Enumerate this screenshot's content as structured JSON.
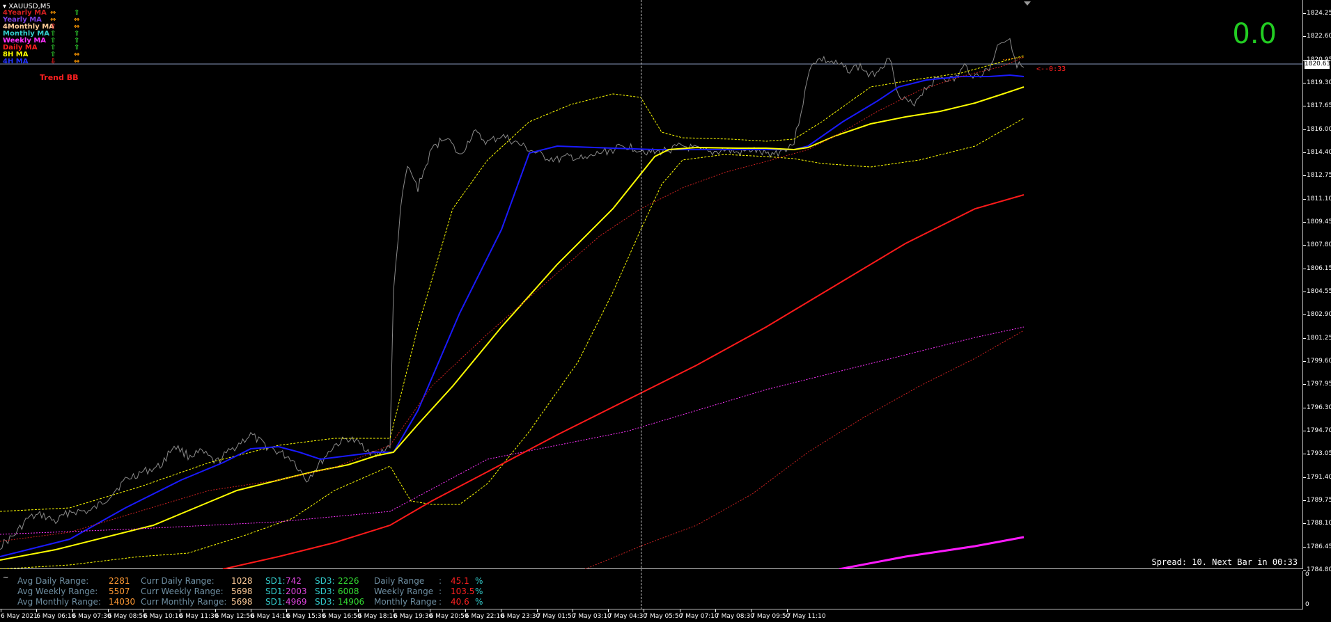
{
  "window": {
    "symbol": "XAUUSD,M5"
  },
  "legend": [
    {
      "name": "4Yearly MA",
      "sym_a": "⇔",
      "sym_b": "⇧",
      "color": "#d02020",
      "a_color": "#ff9900",
      "b_color": "#33dd33"
    },
    {
      "name": "Yearly MA",
      "sym_a": "⇔",
      "sym_b": "⇔",
      "color": "#7b3fe4",
      "a_color": "#ff9900",
      "b_color": "#ff9900"
    },
    {
      "name": "4Monthly MA",
      "sym_a": "⇧",
      "sym_b": "⇔",
      "color": "#ffcc99",
      "a_color": "#ff4444",
      "b_color": "#ff9900"
    },
    {
      "name": "Monthly MA",
      "sym_a": "⇧",
      "sym_b": "⇧",
      "color": "#33cccc",
      "a_color": "#33dd33",
      "b_color": "#33dd33"
    },
    {
      "name": "Weekly MA",
      "sym_a": "⇧",
      "sym_b": "⇧",
      "color": "#ff33ff",
      "a_color": "#33dd33",
      "b_color": "#33dd33"
    },
    {
      "name": "Daily MA",
      "sym_a": "⇧",
      "sym_b": "⇧",
      "color": "#ff2020",
      "a_color": "#33dd33",
      "b_color": "#33dd33"
    },
    {
      "name": "8H MA",
      "sym_a": "⇧",
      "sym_b": "⇔",
      "color": "#ffff00",
      "a_color": "#33dd33",
      "b_color": "#ff9900"
    },
    {
      "name": "4H MA",
      "sym_a": "⇩",
      "sym_b": "⇔",
      "color": "#2233ff",
      "a_color": "#ff2020",
      "b_color": "#ff9900"
    }
  ],
  "trend_label": "Trend BB",
  "big_value": "0.0",
  "price_axis": {
    "ticks": [
      "1824.25",
      "1822.60",
      "1820.95",
      "1819.30",
      "1817.65",
      "1816.00",
      "1814.40",
      "1812.75",
      "1811.10",
      "1809.45",
      "1807.80",
      "1806.15",
      "1804.55",
      "1802.90",
      "1801.25",
      "1799.60",
      "1797.95",
      "1796.30",
      "1794.70",
      "1793.05",
      "1791.40",
      "1789.75",
      "1788.10",
      "1786.45",
      "1784.80"
    ],
    "current_price": "1820.63",
    "range": [
      1784.8,
      1825.1
    ]
  },
  "price_arrow_label": "<--0:33",
  "spread_text": "Spread: 10. Next Bar in 00:33",
  "sub_panel": {
    "label": "~",
    "axis_top": "0",
    "axis_bottom": "0"
  },
  "stats": [
    {
      "label": "Avg Daily Range:",
      "value": "2281",
      "curr_label": "Curr Daily Range:",
      "curr_value": "1028",
      "sd1_label": "SD1:",
      "sd1_value": "742",
      "sd3_label": "SD3:",
      "sd3_value": "2226",
      "range_label": "Daily Range",
      "colon": ":",
      "pct": "45.1",
      "pct_sign": "%"
    },
    {
      "label": "Avg Weekly Range:",
      "value": "5507",
      "curr_label": "Curr Weekly Range:",
      "curr_value": "5698",
      "sd1_label": "SD1:",
      "sd1_value": "2003",
      "sd3_label": "SD3:",
      "sd3_value": "6008",
      "range_label": "Weekly Range",
      "colon": ":",
      "pct": "103.5",
      "pct_sign": "%"
    },
    {
      "label": "Avg Monthly Range:",
      "value": "14030",
      "curr_label": "Curr Monthly Range:",
      "curr_value": "5698",
      "sd1_label": "SD1:",
      "sd1_value": "4969",
      "sd3_label": "SD3:",
      "sd3_value": "14906",
      "range_label": "Monthly Range",
      "colon": ":",
      "pct": "40.6",
      "pct_sign": "%"
    }
  ],
  "time_axis": {
    "ticks": [
      "6 May 2021",
      "6 May 06:10",
      "6 May 07:30",
      "6 May 08:50",
      "6 May 10:10",
      "6 May 11:30",
      "6 May 12:50",
      "6 May 14:10",
      "6 May 15:30",
      "6 May 16:50",
      "6 May 18:10",
      "6 May 19:30",
      "6 May 20:50",
      "6 May 22:10",
      "6 May 23:30",
      "7 May 01:50",
      "7 May 03:10",
      "7 May 04:30",
      "7 May 05:50",
      "7 May 07:10",
      "7 May 08:30",
      "7 May 09:50",
      "7 May 11:10"
    ]
  },
  "colors": {
    "price_line": "#8a8a8a",
    "ma_4h": "#1a1aff",
    "ma_8h": "#ffff00",
    "ma_daily": "#ff1a1a",
    "ma_weekly": "#ff1aff",
    "bb_band": "#ffff00",
    "red_dotted": "#cc2222",
    "magenta_dotted": "#ff33ff",
    "stat_label": "#6d8da0",
    "stat_value": "#ff9933",
    "curr_value": "#ffcc99",
    "sd1_label": "#33cccc",
    "sd1_value": "#dd44dd",
    "sd3_label": "#33cccc",
    "sd3_value": "#33dd33",
    "range_label": "#6d8da0",
    "pct": "#ff2020"
  }
}
